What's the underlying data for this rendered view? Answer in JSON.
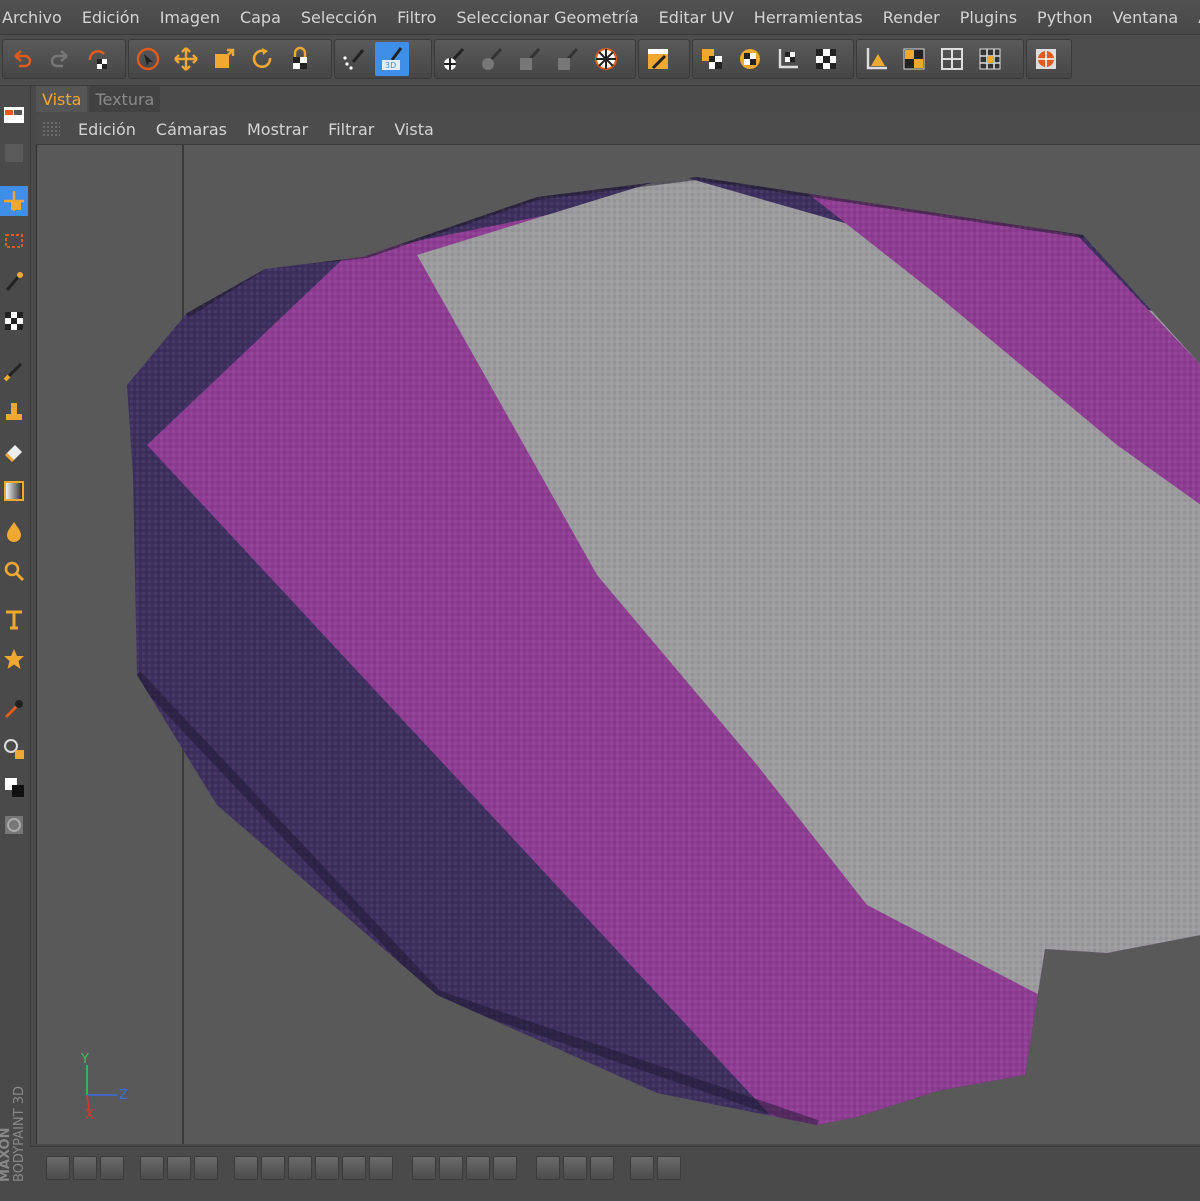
{
  "menubar": {
    "items": [
      "Archivo",
      "Edición",
      "Imagen",
      "Capa",
      "Selección",
      "Filtro",
      "Seleccionar Geometría",
      "Editar UV",
      "Herramientas",
      "Render",
      "Plugins",
      "Python",
      "Ventana",
      "Ayuda"
    ]
  },
  "toolbar": {
    "undo_icon": "undo-icon",
    "redo_icon": "redo-icon",
    "active_tool": "paint-3d-mode"
  },
  "tabs": [
    {
      "label": "Vista",
      "active": true
    },
    {
      "label": "Textura",
      "active": false
    }
  ],
  "view_menu": {
    "items": [
      "Edición",
      "Cámaras",
      "Mostrar",
      "Filtrar",
      "Vista"
    ]
  },
  "viewport": {
    "axis": {
      "y": "Y",
      "z": "Z",
      "x": "X"
    },
    "colors": {
      "purple": "#8e3d93",
      "dark_purple": "#3d2f5e",
      "gray": "#9c9b9e",
      "bg": "#595959"
    }
  },
  "brand": {
    "line1": "MAXON",
    "line2": "BODYPAINT 3D"
  },
  "colors": {
    "accent": "#f0a830",
    "active_blue": "#3f8fe8"
  }
}
